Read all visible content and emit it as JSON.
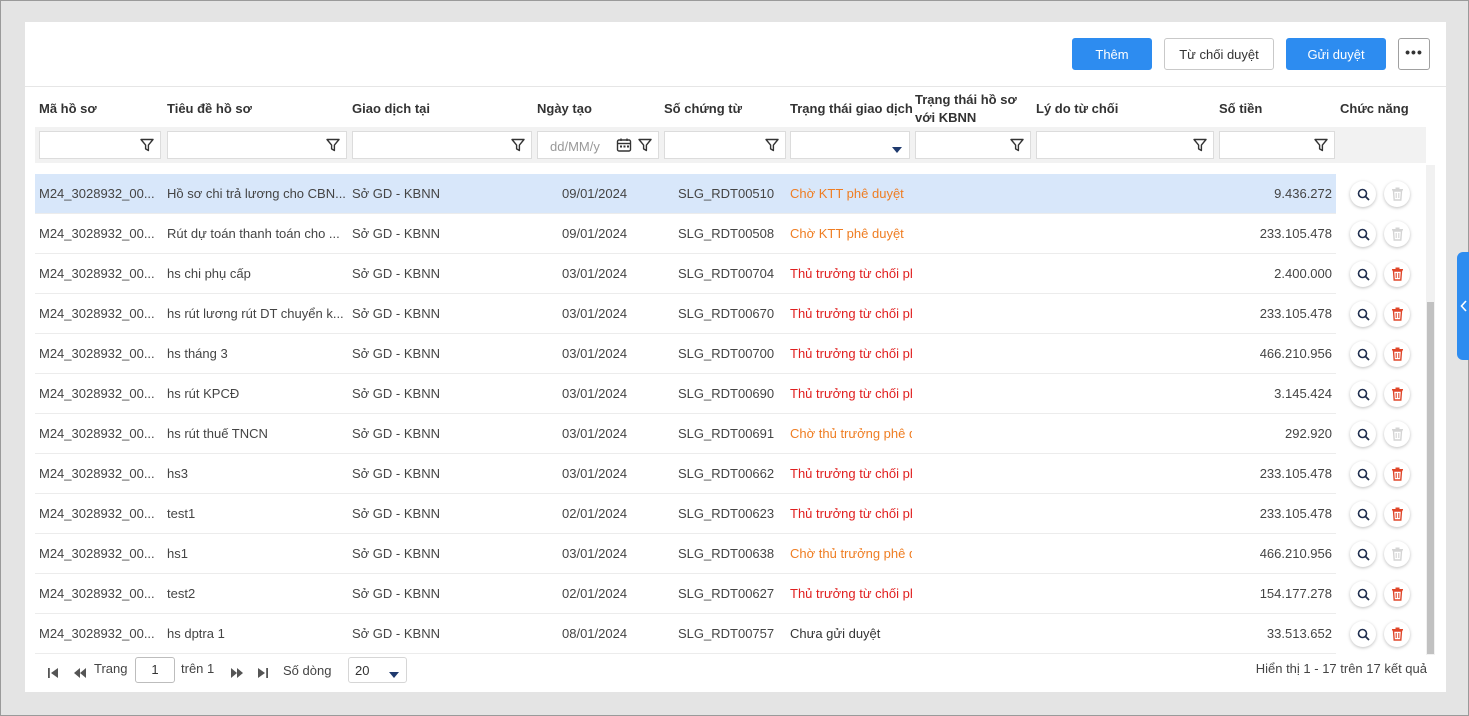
{
  "toolbar": {
    "add_label": "Thêm",
    "reject_label": "Từ chối duyệt",
    "send_label": "Gửi duyệt",
    "more_label": "•••"
  },
  "columns": [
    "Mã hồ sơ",
    "Tiêu đề hồ sơ",
    "Giao dịch tại",
    "Ngày tạo",
    "Số chứng từ",
    "Trạng thái giao dịch",
    "Trạng thái hồ sơ với KBNN",
    "Lý do từ chối",
    "Số tiền",
    "Chức năng"
  ],
  "filters": {
    "date_placeholder": "dd/MM/y"
  },
  "rows": [
    {
      "ma": "M24_3028932_00...",
      "tieude": "Hồ sơ chi trả lương cho CBN...",
      "giaodich": "Sở GD - KBNN",
      "ngay": "09/01/2024",
      "soct": "SLG_RDT00510",
      "trangthai": "Chờ KTT phê duyệt",
      "status_color": "orange",
      "sotien": "9.436.272",
      "deletable": false
    },
    {
      "ma": "M24_3028932_00...",
      "tieude": "Rút dự toán thanh toán cho ...",
      "giaodich": "Sở GD - KBNN",
      "ngay": "09/01/2024",
      "soct": "SLG_RDT00508",
      "trangthai": "Chờ KTT phê duyệt",
      "status_color": "orange",
      "sotien": "233.105.478",
      "deletable": false
    },
    {
      "ma": "M24_3028932_00...",
      "tieude": "hs chi phụ cấp",
      "giaodich": "Sở GD - KBNN",
      "ngay": "03/01/2024",
      "soct": "SLG_RDT00704",
      "trangthai": "Thủ trưởng từ chối ph",
      "status_color": "red",
      "sotien": "2.400.000",
      "deletable": true
    },
    {
      "ma": "M24_3028932_00...",
      "tieude": "hs rút lương rút DT chuyển k...",
      "giaodich": "Sở GD - KBNN",
      "ngay": "03/01/2024",
      "soct": "SLG_RDT00670",
      "trangthai": "Thủ trưởng từ chối ph",
      "status_color": "red",
      "sotien": "233.105.478",
      "deletable": true
    },
    {
      "ma": "M24_3028932_00...",
      "tieude": "hs tháng 3",
      "giaodich": "Sở GD - KBNN",
      "ngay": "03/01/2024",
      "soct": "SLG_RDT00700",
      "trangthai": "Thủ trưởng từ chối ph",
      "status_color": "red",
      "sotien": "466.210.956",
      "deletable": true
    },
    {
      "ma": "M24_3028932_00...",
      "tieude": "hs rút KPCĐ",
      "giaodich": "Sở GD - KBNN",
      "ngay": "03/01/2024",
      "soct": "SLG_RDT00690",
      "trangthai": "Thủ trưởng từ chối ph",
      "status_color": "red",
      "sotien": "3.145.424",
      "deletable": true
    },
    {
      "ma": "M24_3028932_00...",
      "tieude": "hs rút thuế TNCN",
      "giaodich": "Sở GD - KBNN",
      "ngay": "03/01/2024",
      "soct": "SLG_RDT00691",
      "trangthai": "Chờ thủ trưởng phê d",
      "status_color": "orange",
      "sotien": "292.920",
      "deletable": false
    },
    {
      "ma": "M24_3028932_00...",
      "tieude": "hs3",
      "giaodich": "Sở GD - KBNN",
      "ngay": "03/01/2024",
      "soct": "SLG_RDT00662",
      "trangthai": "Thủ trưởng từ chối ph",
      "status_color": "red",
      "sotien": "233.105.478",
      "deletable": true
    },
    {
      "ma": "M24_3028932_00...",
      "tieude": "test1",
      "giaodich": "Sở GD - KBNN",
      "ngay": "02/01/2024",
      "soct": "SLG_RDT00623",
      "trangthai": "Thủ trưởng từ chối ph",
      "status_color": "red",
      "sotien": "233.105.478",
      "deletable": true
    },
    {
      "ma": "M24_3028932_00...",
      "tieude": "hs1",
      "giaodich": "Sở GD - KBNN",
      "ngay": "03/01/2024",
      "soct": "SLG_RDT00638",
      "trangthai": "Chờ thủ trưởng phê d",
      "status_color": "orange",
      "sotien": "466.210.956",
      "deletable": false
    },
    {
      "ma": "M24_3028932_00...",
      "tieude": "test2",
      "giaodich": "Sở GD - KBNN",
      "ngay": "02/01/2024",
      "soct": "SLG_RDT00627",
      "trangthai": "Thủ trưởng từ chối ph",
      "status_color": "red",
      "sotien": "154.177.278",
      "deletable": true
    },
    {
      "ma": "M24_3028932_00...",
      "tieude": "hs dptra 1",
      "giaodich": "Sở GD - KBNN",
      "ngay": "08/01/2024",
      "soct": "SLG_RDT00757",
      "trangthai": "Chưa gửi duyệt",
      "status_color": "dark",
      "sotien": "33.513.652",
      "deletable": true
    }
  ],
  "pager": {
    "page_label": "Trang",
    "page_value": "1",
    "of_label": "trên 1",
    "rows_label": "Số dòng",
    "rows_value": "20",
    "summary": "Hiển thị 1 - 17 trên 17 kết quả"
  },
  "colors": {
    "primary": "#2d8cf0",
    "status_orange": "#ef7d22",
    "status_red": "#e02020",
    "selected_row": "#d8e7fa"
  }
}
